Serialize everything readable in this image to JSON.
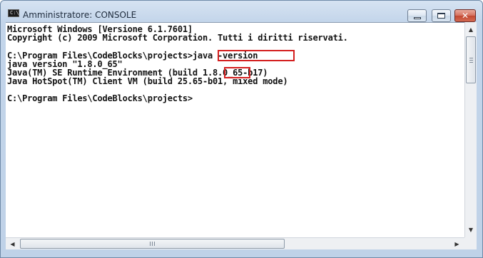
{
  "window": {
    "title": "Amministratore: CONSOLE",
    "icon": "console-icon",
    "controls": {
      "minimize": "minimize-icon",
      "maximize": "maximize-icon",
      "close": "close-icon"
    }
  },
  "console": {
    "lines": [
      "Microsoft Windows [Versione 6.1.7601]",
      "Copyright (c) 2009 Microsoft Corporation. Tutti i diritti riservati.",
      "",
      "C:\\Program Files\\CodeBlocks\\projects>java -version",
      "java version \"1.8.0_65\"",
      "Java(TM) SE Runtime Environment (build 1.8.0_65-b17)",
      "Java HotSpot(TM) Client VM (build 25.65-b01, mixed mode)",
      "",
      "C:\\Program Files\\CodeBlocks\\projects>"
    ],
    "text_color": "#111111",
    "background_color": "#ffffff",
    "highlight_color": "#d41f1f"
  }
}
